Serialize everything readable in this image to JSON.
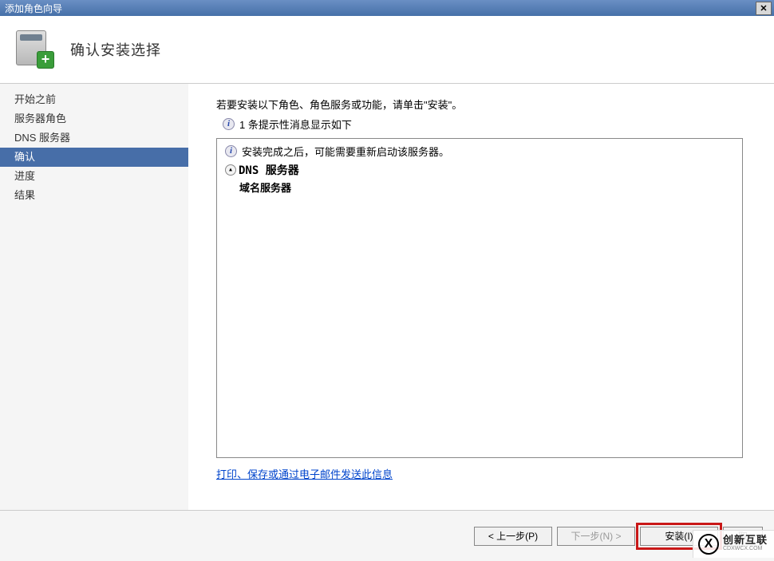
{
  "window": {
    "title": "添加角色向导"
  },
  "header": {
    "title": "确认安装选择"
  },
  "sidebar": {
    "items": [
      {
        "label": "开始之前",
        "selected": false
      },
      {
        "label": "服务器角色",
        "selected": false
      },
      {
        "label": "DNS 服务器",
        "selected": false
      },
      {
        "label": "确认",
        "selected": true
      },
      {
        "label": "进度",
        "selected": false
      },
      {
        "label": "结果",
        "selected": false
      }
    ]
  },
  "main": {
    "intro": "若要安装以下角色、角色服务或功能，请单击\"安装\"。",
    "info_count": "1 条提示性消息显示如下",
    "restart_note": "安装完成之后，可能需要重新启动该服务器。",
    "role": "DNS 服务器",
    "subrole": "域名服务器",
    "link": "打印、保存或通过电子邮件发送此信息"
  },
  "footer": {
    "prev": "< 上一步(P)",
    "next": "下一步(N) >",
    "install": "安装(I)",
    "cancel": "取"
  },
  "watermark": {
    "brand": "创新互联",
    "sub": "CDXWCX.COM"
  }
}
